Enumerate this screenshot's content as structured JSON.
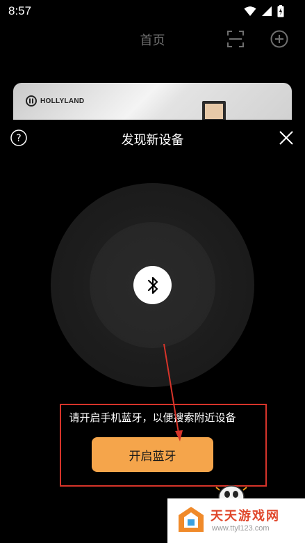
{
  "status_bar": {
    "time": "8:57",
    "icons": [
      "wifi-icon",
      "signal-icon",
      "battery-icon"
    ]
  },
  "header": {
    "title": "首页",
    "icons": [
      "scan-icon",
      "add-icon"
    ]
  },
  "device_card": {
    "brand": "HOLLYLAND"
  },
  "dialog": {
    "title": "发现新设备",
    "help_icon": "help-icon",
    "close_icon": "close-icon",
    "center_icon": "bluetooth-icon",
    "hint": "请开启手机蓝牙，以便搜索附近设备",
    "button_label": "开启蓝牙"
  },
  "watermark": {
    "main": "天天游戏网",
    "sub": "www.ttyl123.com"
  },
  "colors": {
    "button": "#f5a54b",
    "annotation": "#d6342a",
    "background": "#000000"
  }
}
